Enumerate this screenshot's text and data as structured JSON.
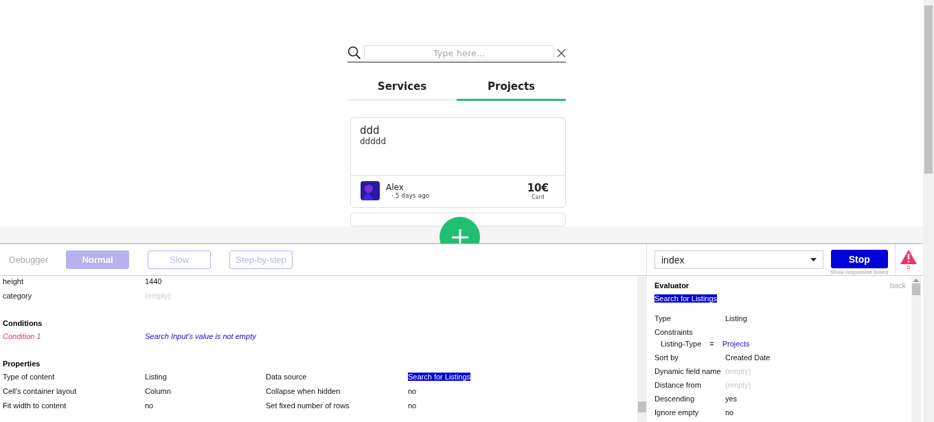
{
  "search": {
    "placeholder": "Type here..."
  },
  "tabs": [
    {
      "label": "Services",
      "selected": false
    },
    {
      "label": "Projects",
      "selected": true
    }
  ],
  "cards": [
    {
      "title": "ddd",
      "subtitle": "ddddd",
      "author": "Alex",
      "time": "· 5 days ago",
      "price": "10€",
      "payment": "Card"
    }
  ],
  "debugger": {
    "title": "Debugger",
    "speeds": [
      {
        "label": "Normal",
        "selected": true
      },
      {
        "label": "Slow",
        "selected": false
      },
      {
        "label": "Step-by-step",
        "selected": false
      }
    ],
    "page": "index",
    "stop": "Stop",
    "hint": "Show responsive boxes",
    "issues": "5"
  },
  "inspector": {
    "fields": [
      {
        "label": "height",
        "value": "1440",
        "empty": false
      },
      {
        "label": "category",
        "value": "(empty)",
        "empty": true
      }
    ],
    "conditions_title": "Conditions",
    "conditions": [
      {
        "label": "Condition 1",
        "value": "Search Input's value is not empty"
      }
    ],
    "properties_title": "Properties",
    "properties": [
      {
        "label": "Type of content",
        "value": "Listing",
        "label_2": "Data source",
        "value_2": "Search for Listings",
        "highlighted": true
      },
      {
        "label": "Cell's container layout",
        "value": "Column",
        "label_2": "Collapse when hidden",
        "value_2": "no",
        "highlighted": false
      },
      {
        "label": "Fit width to content",
        "value": "no",
        "label_2": "Set fixed number of rows",
        "value_2": "no",
        "highlighted": false
      }
    ]
  },
  "evaluator": {
    "title": "Evaluator",
    "back": "back",
    "expression": "Search for Listings",
    "rows": [
      {
        "kind": "field",
        "label": "Type",
        "value": "Listing",
        "empty": false
      },
      {
        "kind": "heading",
        "label": "Constraints"
      },
      {
        "kind": "constraint",
        "label": "Listing-Type",
        "operator": "=",
        "value": "Projects"
      },
      {
        "kind": "field",
        "label": "Sort by",
        "value": "Created Date",
        "empty": false
      },
      {
        "kind": "field",
        "label": "Dynamic field name",
        "value": "(empty)",
        "empty": true
      },
      {
        "kind": "field",
        "label": "Distance from",
        "value": "(empty)",
        "empty": true
      },
      {
        "kind": "field",
        "label": "Descending",
        "value": "yes",
        "empty": false
      },
      {
        "kind": "field",
        "label": "Ignore empty",
        "value": "no",
        "empty": false
      }
    ]
  }
}
